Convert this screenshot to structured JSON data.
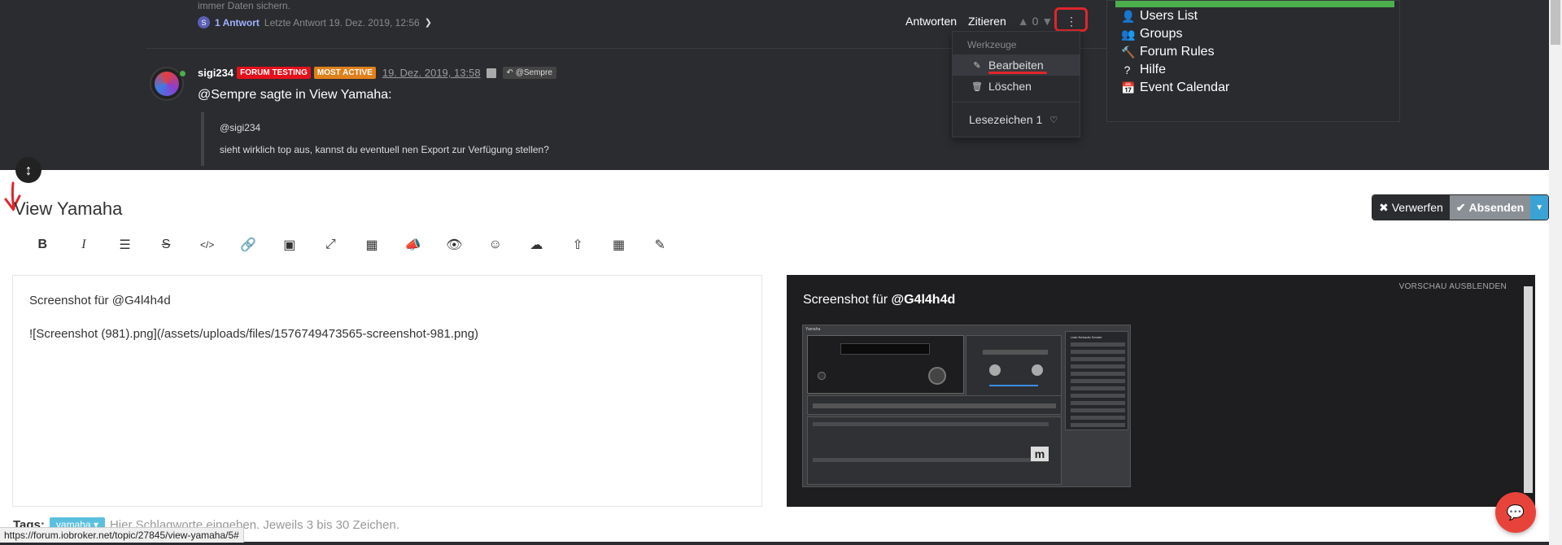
{
  "forum": {
    "prev_text": "immer Daten sichern.",
    "reply_avatar": "S",
    "reply_count": "1 Antwort",
    "last_reply": "Letzte Antwort 19. Dez. 2019, 12:56",
    "actions": {
      "reply": "Antworten",
      "quote": "Zitieren",
      "votes": "0"
    },
    "post": {
      "user": "sigi234",
      "badge1": "FORUM TESTING",
      "badge2": "MOST ACTIVE",
      "date": "19. Dez. 2019, 13:58",
      "mention_tag": "@Sempre",
      "line_user": "@Sempre",
      "line_mid": " sagte in ",
      "line_topic": "View Yamaha",
      "line_end": ":",
      "quote_user": "@sigi234",
      "quote_text": "sieht wirklich top aus, kannst du eventuell nen Export zur Verfügung stellen?"
    },
    "dropdown": {
      "header": "Werkzeuge",
      "edit": "Bearbeiten",
      "delete": "Löschen",
      "bookmark": "Lesezeichen 1"
    },
    "side_menu": [
      "Users List",
      "Groups",
      "Forum Rules",
      "Hilfe",
      "Event Calendar"
    ]
  },
  "composer": {
    "title": "View Yamaha",
    "discard": "Verwerfen",
    "submit": "Absenden",
    "toolbar": [
      "bold-icon",
      "italic-icon",
      "list-icon",
      "strikethrough-icon",
      "code-icon",
      "link-icon",
      "image-icon",
      "fullscreen-icon",
      "chart-icon",
      "announce-icon",
      "eye-icon",
      "smiley-icon",
      "cloud-upload-icon",
      "upload-icon",
      "grid-icon",
      "eyedropper-icon"
    ],
    "editor_line1": "Screenshot für @G4l4h4d",
    "editor_line2": "![Screenshot (981).png](/assets/uploads/files/1576749473565-screenshot-981.png)",
    "preview_hide": "VORSCHAU AUSBLENDEN",
    "preview_text": "Screenshot für ",
    "preview_mention": "@G4l4h4d",
    "shot": {
      "title": "Yamaha",
      "list_title": "Liste Netradio Sender",
      "logo": "m"
    },
    "tags_label": "Tags:",
    "tag": "yamaha",
    "tags_hint": "Hier Schlagworte eingeben. Jeweils 3 bis 30 Zeichen."
  },
  "status_url": "https://forum.iobroker.net/topic/27845/view-yamaha/5#",
  "colors": {
    "accent_red": "#e0262b",
    "green": "#4cae4c",
    "dark": "#2b2c30",
    "tag_blue": "#5bc0de"
  }
}
